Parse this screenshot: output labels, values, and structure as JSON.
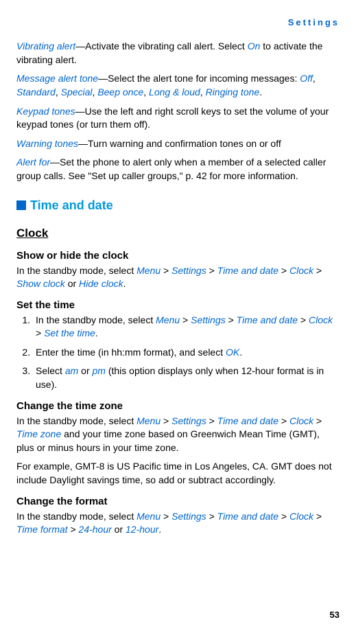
{
  "header": "Settings",
  "intro": {
    "vibrating": {
      "term": "Vibrating alert",
      "text1": "—Activate the vibrating call alert. Select ",
      "on": "On",
      "text2": " to activate the vibrating alert."
    },
    "message": {
      "term": "Message alert tone",
      "text1": "—Select the alert tone for incoming messages: ",
      "opts": [
        "Off",
        "Standard",
        "Special",
        "Beep once",
        "Long & loud",
        "Ringing tone"
      ],
      "end": "."
    },
    "keypad": {
      "term": "Keypad tones",
      "text": "—Use the left and right scroll keys to set the volume of your keypad tones (or turn them off)."
    },
    "warning": {
      "term": "Warning tones",
      "text": "—Turn warning and confirmation tones on or off"
    },
    "alertfor": {
      "term": "Alert for",
      "text": "—Set the phone to alert only when a member of a selected caller group calls. See \"Set up caller groups,\" p. 42 for more information."
    }
  },
  "section": {
    "title": "Time and date"
  },
  "clock": {
    "title": "Clock",
    "showhide": {
      "title": "Show or hide the clock",
      "text1": "In the standby mode, select ",
      "menu": "Menu",
      "settings": "Settings",
      "timedate": "Time and date",
      "clock": "Clock",
      "showclock": "Show clock",
      "or": " or ",
      "hideclock": "Hide clock",
      "end": "."
    },
    "settime": {
      "title": "Set the time",
      "step1a": "In the standby mode, select ",
      "menu": "Menu",
      "settings": "Settings",
      "timedate": "Time and date",
      "clock": "Clock",
      "setthetime": "Set the time",
      "end": ".",
      "step2a": "Enter the time (in hh:mm format), and select ",
      "ok": "OK",
      "step2end": ".",
      "step3a": "Select ",
      "am": "am",
      "or": " or ",
      "pm": "pm",
      "step3b": " (this option displays only when 12-hour format is in use)."
    },
    "timezone": {
      "title": "Change the time zone",
      "text1": "In the standby mode, select ",
      "menu": "Menu",
      "settings": "Settings",
      "timedate": "Time and date",
      "clock": "Clock",
      "timezone": "Time zone",
      "text2": " and your time zone based on Greenwich Mean Time (GMT), plus or minus hours in your time zone.",
      "text3": "For example, GMT-8 is US Pacific time in Los Angeles, CA. GMT does not include Daylight savings time, so add or subtract accordingly."
    },
    "format": {
      "title": "Change the format",
      "text1": "In the standby mode, select ",
      "menu": "Menu",
      "settings": "Settings",
      "timedate": "Time and date",
      "clock": "Clock",
      "timeformat": "Time format",
      "h24": "24-hour",
      "or": " or ",
      "h12": "12-hour",
      "end": "."
    }
  },
  "page": "53",
  "gt": " > ",
  "comma": ", "
}
